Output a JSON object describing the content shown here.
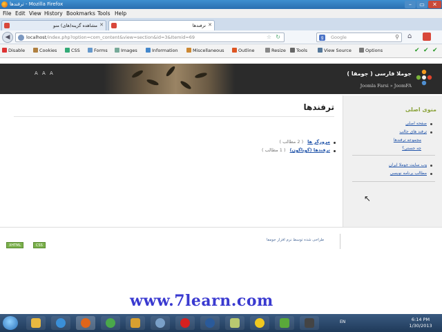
{
  "window": {
    "title": "ترفندها - Mozilla Firefox"
  },
  "menubar": [
    "File",
    "Edit",
    "View",
    "History",
    "Bookmarks",
    "Tools",
    "Help"
  ],
  "tabs": [
    {
      "label": "مشاهده گزینه(های) منو",
      "active": false
    },
    {
      "label": "ترفندها",
      "active": true
    }
  ],
  "nav": {
    "url_host": "localhost",
    "url_path": "/index.php?option=com_content&view=section&id=3&Itemid=69",
    "search_placeholder": "Google"
  },
  "devbar": [
    "Disable",
    "Cookies",
    "CSS",
    "Forms",
    "Images",
    "Information",
    "Miscellaneous",
    "Outline",
    "Resize",
    "Tools",
    "View Source",
    "Options"
  ],
  "site": {
    "font_sizer": "A A A",
    "brand": "جوملا فارسی ( جومفا )",
    "brand_sub": "Joomla Farsi » JoomFA"
  },
  "sidebar": {
    "title": "منوی اصلی",
    "links": [
      "صفحه اصلی",
      "ترفند های جالب",
      "مجموعه ترفندها",
      "چه جستی؟",
      "وب سایت جوملا ایران",
      "مطالب برنامه نویسی"
    ]
  },
  "content": {
    "title": "ترفندها",
    "sections": [
      {
        "name": "مرورگر ها",
        "count": "( 2 مطالب )"
      },
      {
        "name": "ترفندها (گوناگون)",
        "count": "( 1 مطالب )"
      }
    ]
  },
  "footer": {
    "credit": "طراحی شده توسط نرم افزار جومفا",
    "badges": [
      "XHTML",
      "CSS"
    ]
  },
  "watermark": "www.7learn.com",
  "taskbar": {
    "lang": "EN",
    "time": "6:14 PM",
    "date": "1/30/2013"
  },
  "colors": {
    "accent_green": "#8aa23a",
    "link_blue": "#2255aa",
    "header_dark": "#2b2b2b"
  }
}
